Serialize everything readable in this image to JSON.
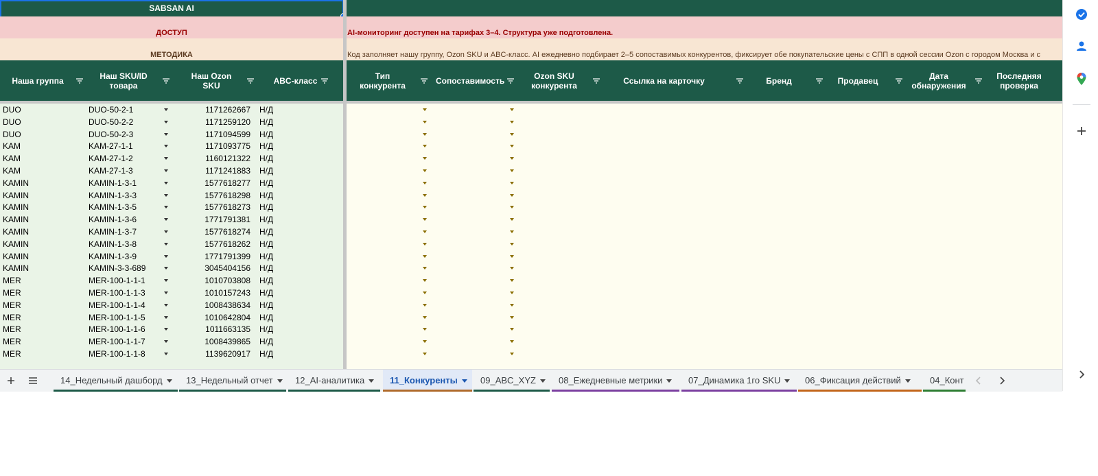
{
  "sheet": {
    "title": "SABSAN AI",
    "access_label": "ДОСТУП",
    "access_text": "AI-мониторинг доступен на тарифах 3–4. Структура уже подготовлена.",
    "method_label": "МЕТОДИКА",
    "method_text": "Код заполняет нашу группу, Ozon SKU и ABC-класс. AI ежедневно подбирает 2–5 сопоставимых конкурентов, фиксирует обе покупательские цены с СПП в одной сессии Ozon с городом Москва и с",
    "headers": [
      "Наша группа",
      "Наш SKU/ID товара",
      "Наш Ozon SKU",
      "ABC-класс",
      "Тип конкурента",
      "Сопоставимость",
      "Ozon SKU конкурента",
      "Ссылка на карточку",
      "Бренд",
      "Продавец",
      "Дата обнаружения",
      "Последняя проверка"
    ],
    "rows": [
      {
        "group": "DUO",
        "sku": "DUO-50-2-1",
        "ozon": "1171262667",
        "abc": "Н/Д"
      },
      {
        "group": "DUO",
        "sku": "DUO-50-2-2",
        "ozon": "1171259120",
        "abc": "Н/Д"
      },
      {
        "group": "DUO",
        "sku": "DUO-50-2-3",
        "ozon": "1171094599",
        "abc": "Н/Д"
      },
      {
        "group": "KAM",
        "sku": "KAM-27-1-1",
        "ozon": "1171093775",
        "abc": "Н/Д"
      },
      {
        "group": "KAM",
        "sku": "KAM-27-1-2",
        "ozon": "1160121322",
        "abc": "Н/Д"
      },
      {
        "group": "KAM",
        "sku": "KAM-27-1-3",
        "ozon": "1171241883",
        "abc": "Н/Д"
      },
      {
        "group": "KAMIN",
        "sku": "KAMIN-1-3-1",
        "ozon": "1577618277",
        "abc": "Н/Д"
      },
      {
        "group": "KAMIN",
        "sku": "KAMIN-1-3-3",
        "ozon": "1577618298",
        "abc": "Н/Д"
      },
      {
        "group": "KAMIN",
        "sku": "KAMIN-1-3-5",
        "ozon": "1577618273",
        "abc": "Н/Д"
      },
      {
        "group": "KAMIN",
        "sku": "KAMIN-1-3-6",
        "ozon": "1771791381",
        "abc": "Н/Д"
      },
      {
        "group": "KAMIN",
        "sku": "KAMIN-1-3-7",
        "ozon": "1577618274",
        "abc": "Н/Д"
      },
      {
        "group": "KAMIN",
        "sku": "KAMIN-1-3-8",
        "ozon": "1577618262",
        "abc": "Н/Д"
      },
      {
        "group": "KAMIN",
        "sku": "KAMIN-1-3-9",
        "ozon": "1771791399",
        "abc": "Н/Д"
      },
      {
        "group": "KAMIN",
        "sku": "KAMIN-3-3-689",
        "ozon": "3045404156",
        "abc": "Н/Д"
      },
      {
        "group": "MER",
        "sku": "MER-100-1-1-1",
        "ozon": "1010703808",
        "abc": "Н/Д"
      },
      {
        "group": "MER",
        "sku": "MER-100-1-1-3",
        "ozon": "1010157243",
        "abc": "Н/Д"
      },
      {
        "group": "MER",
        "sku": "MER-100-1-1-4",
        "ozon": "1008438634",
        "abc": "Н/Д"
      },
      {
        "group": "MER",
        "sku": "MER-100-1-1-5",
        "ozon": "1010642804",
        "abc": "Н/Д"
      },
      {
        "group": "MER",
        "sku": "MER-100-1-1-6",
        "ozon": "1011663135",
        "abc": "Н/Д"
      },
      {
        "group": "MER",
        "sku": "MER-100-1-1-7",
        "ozon": "1008439865",
        "abc": "Н/Д"
      },
      {
        "group": "MER",
        "sku": "MER-100-1-1-8",
        "ozon": "1139620917",
        "abc": "Н/Д"
      }
    ]
  },
  "tabs": [
    {
      "label": "14_Недельный дашборд",
      "color": "#1d5a48",
      "active": false
    },
    {
      "label": "13_Недельный отчет",
      "color": "#1d5a48",
      "active": false
    },
    {
      "label": "12_AI-аналитика",
      "color": "#1d5a48",
      "active": false
    },
    {
      "label": "11_Конкуренты",
      "color": "#b06a2b",
      "active": true
    },
    {
      "label": "09_ABC_XYZ",
      "color": "#1d5a48",
      "active": false
    },
    {
      "label": "08_Ежедневные метрики",
      "color": "#7b3fa0",
      "active": false
    },
    {
      "label": "07_Динамика 1го SKU",
      "color": "#7b3fa0",
      "active": false
    },
    {
      "label": "06_Фиксация действий",
      "color": "#c2651a",
      "active": false
    },
    {
      "label": "04_Конт",
      "color": "#2e7d32",
      "active": false
    }
  ],
  "icons": {
    "add_sheet": "plus-icon",
    "all_sheets": "menu-icon",
    "tasks": "tasks-icon",
    "contacts": "contacts-icon",
    "maps": "maps-icon",
    "add_addon": "plus-icon",
    "scroll_left": "chevron-left-icon",
    "scroll_right": "chevron-right-icon",
    "expand_panel": "chevron-right-icon"
  }
}
